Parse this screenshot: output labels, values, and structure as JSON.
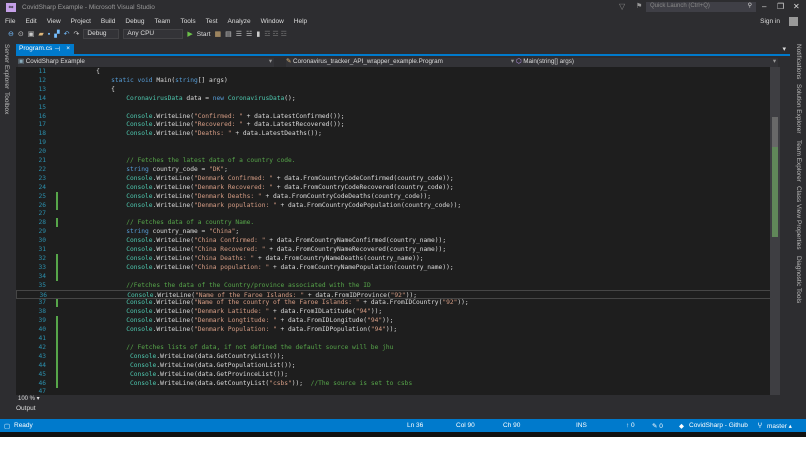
{
  "window": {
    "title": "CovidSharp Example - Microsoft Visual Studio",
    "quick_launch": "Quick Launch (Ctrl+Q)",
    "sign_in": "Sign in"
  },
  "menu": [
    "File",
    "Edit",
    "View",
    "Project",
    "Build",
    "Debug",
    "Team",
    "Tools",
    "Test",
    "Analyze",
    "Window",
    "Help"
  ],
  "toolbar": {
    "config": "Debug",
    "platform": "Any CPU",
    "start": "Start"
  },
  "left_rail": [
    "Server Explorer",
    "Toolbox"
  ],
  "right_rail": [
    "Notifications",
    "Solution Explorer",
    "Team Explorer",
    "Class View",
    "Properties",
    "Diagnostic Tools"
  ],
  "tab": {
    "label": "Program.cs",
    "pin": "⊣",
    "close": "×"
  },
  "navbar": {
    "project": "CovidSharp Example",
    "class": "Coronavirus_tracker_API_wrapper_example.Program",
    "member": "Main(string[] args)"
  },
  "code": [
    {
      "n": "11",
      "seg": [
        [
          "p",
          "        {"
        ]
      ]
    },
    {
      "n": "12",
      "seg": [
        [
          "p",
          "            "
        ],
        [
          "k",
          "static"
        ],
        [
          "p",
          " "
        ],
        [
          "k",
          "void"
        ],
        [
          "p",
          " Main("
        ],
        [
          "k",
          "string"
        ],
        [
          "p",
          "[] args)"
        ]
      ]
    },
    {
      "n": "13",
      "seg": [
        [
          "p",
          "            {"
        ]
      ]
    },
    {
      "n": "14",
      "seg": [
        [
          "p",
          "                "
        ],
        [
          "t",
          "CoronavirusData"
        ],
        [
          "p",
          " data = "
        ],
        [
          "k",
          "new"
        ],
        [
          "p",
          " "
        ],
        [
          "t",
          "CoronavirusData"
        ],
        [
          "p",
          "();"
        ]
      ]
    },
    {
      "n": "15",
      "seg": []
    },
    {
      "n": "16",
      "seg": [
        [
          "p",
          "                "
        ],
        [
          "t",
          "Console"
        ],
        [
          "p",
          ".WriteLine("
        ],
        [
          "s",
          "\"Confirmed: \""
        ],
        [
          "p",
          " + data.LatestConfirmed());"
        ]
      ]
    },
    {
      "n": "17",
      "seg": [
        [
          "p",
          "                "
        ],
        [
          "t",
          "Console"
        ],
        [
          "p",
          ".WriteLine("
        ],
        [
          "s",
          "\"Recovered: \""
        ],
        [
          "p",
          " + data.LatestRecovered());"
        ]
      ]
    },
    {
      "n": "18",
      "seg": [
        [
          "p",
          "                "
        ],
        [
          "t",
          "Console"
        ],
        [
          "p",
          ".WriteLine("
        ],
        [
          "s",
          "\"Deaths: \""
        ],
        [
          "p",
          " + data.LatestDeaths());"
        ]
      ]
    },
    {
      "n": "19",
      "seg": []
    },
    {
      "n": "20",
      "seg": []
    },
    {
      "n": "21",
      "seg": [
        [
          "p",
          "                "
        ],
        [
          "c",
          "// Fetches the latest data of a country code."
        ]
      ]
    },
    {
      "n": "22",
      "seg": [
        [
          "p",
          "                "
        ],
        [
          "k",
          "string"
        ],
        [
          "p",
          " country_code = "
        ],
        [
          "s",
          "\"DK\""
        ],
        [
          "p",
          ";"
        ]
      ]
    },
    {
      "n": "23",
      "seg": [
        [
          "p",
          "                "
        ],
        [
          "t",
          "Console"
        ],
        [
          "p",
          ".WriteLine("
        ],
        [
          "s",
          "\"Denmark Confirmed: \""
        ],
        [
          "p",
          " + data.FromCountryCodeConfirmed(country_code));"
        ]
      ]
    },
    {
      "n": "24",
      "seg": [
        [
          "p",
          "                "
        ],
        [
          "t",
          "Console"
        ],
        [
          "p",
          ".WriteLine("
        ],
        [
          "s",
          "\"Denmark Recovered: \""
        ],
        [
          "p",
          " + data.FromCountryCodeRecovered(country_code));"
        ]
      ]
    },
    {
      "n": "25",
      "chg": true,
      "seg": [
        [
          "p",
          "                "
        ],
        [
          "t",
          "Console"
        ],
        [
          "p",
          ".WriteLine("
        ],
        [
          "s",
          "\"Denmark Deaths: \""
        ],
        [
          "p",
          " + data.FromCountryCodeDeaths(country_code));"
        ]
      ]
    },
    {
      "n": "26",
      "chg": true,
      "seg": [
        [
          "p",
          "                "
        ],
        [
          "t",
          "Console"
        ],
        [
          "p",
          ".WriteLine("
        ],
        [
          "s",
          "\"Denmark population: \""
        ],
        [
          "p",
          " + data.FromCountryCodePopulation(country_code));"
        ]
      ]
    },
    {
      "n": "27",
      "seg": []
    },
    {
      "n": "28",
      "chg": true,
      "seg": [
        [
          "p",
          "                "
        ],
        [
          "c",
          "// Fetches data of a country Name."
        ]
      ]
    },
    {
      "n": "29",
      "seg": [
        [
          "p",
          "                "
        ],
        [
          "k",
          "string"
        ],
        [
          "p",
          " country_name = "
        ],
        [
          "s",
          "\"China\""
        ],
        [
          "p",
          ";"
        ]
      ]
    },
    {
      "n": "30",
      "seg": [
        [
          "p",
          "                "
        ],
        [
          "t",
          "Console"
        ],
        [
          "p",
          ".WriteLine("
        ],
        [
          "s",
          "\"China Confirmed: \""
        ],
        [
          "p",
          " + data.FromCountryNameConfirmed(country_name));"
        ]
      ]
    },
    {
      "n": "31",
      "seg": [
        [
          "p",
          "                "
        ],
        [
          "t",
          "Console"
        ],
        [
          "p",
          ".WriteLine("
        ],
        [
          "s",
          "\"China Recovered: \""
        ],
        [
          "p",
          " + data.FromCountryNameRecovered(country_name));"
        ]
      ]
    },
    {
      "n": "32",
      "chg": true,
      "seg": [
        [
          "p",
          "                "
        ],
        [
          "t",
          "Console"
        ],
        [
          "p",
          ".WriteLine("
        ],
        [
          "s",
          "\"China Deaths: \""
        ],
        [
          "p",
          " + data.FromCountryNameDeaths(country_name));"
        ]
      ]
    },
    {
      "n": "33",
      "chg": true,
      "seg": [
        [
          "p",
          "                "
        ],
        [
          "t",
          "Console"
        ],
        [
          "p",
          ".WriteLine("
        ],
        [
          "s",
          "\"China population: \""
        ],
        [
          "p",
          " + data.FromCountryNamePopulation(country_name));"
        ]
      ]
    },
    {
      "n": "34",
      "chg": true,
      "seg": []
    },
    {
      "n": "35",
      "seg": [
        [
          "p",
          "                "
        ],
        [
          "c",
          "//Fetches the data of the Country/province associated with the ID"
        ]
      ]
    },
    {
      "n": "36",
      "cur": true,
      "seg": [
        [
          "p",
          "                "
        ],
        [
          "t",
          "Console"
        ],
        [
          "p",
          ".WriteLine("
        ],
        [
          "s",
          "\"Name of the Faroe Islands: \""
        ],
        [
          "p",
          " + data.FromIDProvince("
        ],
        [
          "s",
          "\"92\""
        ],
        [
          "p",
          "));"
        ]
      ]
    },
    {
      "n": "37",
      "chg": true,
      "seg": [
        [
          "p",
          "                "
        ],
        [
          "t",
          "Console"
        ],
        [
          "p",
          ".WriteLine("
        ],
        [
          "s",
          "\"Name of the country of the Faroe Islands: \""
        ],
        [
          "p",
          " + data.FromIDCountry("
        ],
        [
          "s",
          "\"92\""
        ],
        [
          "p",
          "));"
        ]
      ]
    },
    {
      "n": "38",
      "seg": [
        [
          "p",
          "                "
        ],
        [
          "t",
          "Console"
        ],
        [
          "p",
          ".WriteLine("
        ],
        [
          "s",
          "\"Denmark Latitude: \""
        ],
        [
          "p",
          " + data.FromIDLatitude("
        ],
        [
          "s",
          "\"94\""
        ],
        [
          "p",
          "));"
        ]
      ]
    },
    {
      "n": "39",
      "chg": true,
      "seg": [
        [
          "p",
          "                "
        ],
        [
          "t",
          "Console"
        ],
        [
          "p",
          ".WriteLine("
        ],
        [
          "s",
          "\"Denmark Longtitude: \""
        ],
        [
          "p",
          " + data.FromIDLongitude("
        ],
        [
          "s",
          "\"94\""
        ],
        [
          "p",
          "));"
        ]
      ]
    },
    {
      "n": "40",
      "chg": true,
      "seg": [
        [
          "p",
          "                "
        ],
        [
          "t",
          "Console"
        ],
        [
          "p",
          ".WriteLine("
        ],
        [
          "s",
          "\"Denmark Population: \""
        ],
        [
          "p",
          " + data.FromIDPopulation("
        ],
        [
          "s",
          "\"94\""
        ],
        [
          "p",
          "));"
        ]
      ]
    },
    {
      "n": "41",
      "chg": true,
      "seg": []
    },
    {
      "n": "42",
      "chg": true,
      "seg": [
        [
          "p",
          "                "
        ],
        [
          "c",
          "// Fetches lists of data, if not defined the default source will be jhu"
        ]
      ]
    },
    {
      "n": "43",
      "chg": true,
      "seg": [
        [
          "p",
          "                 "
        ],
        [
          "t",
          "Console"
        ],
        [
          "p",
          ".WriteLine(data.GetCountryList());"
        ]
      ]
    },
    {
      "n": "44",
      "chg": true,
      "seg": [
        [
          "p",
          "                 "
        ],
        [
          "t",
          "Console"
        ],
        [
          "p",
          ".WriteLine(data.GetPopulationList());"
        ]
      ]
    },
    {
      "n": "45",
      "chg": true,
      "seg": [
        [
          "p",
          "                 "
        ],
        [
          "t",
          "Console"
        ],
        [
          "p",
          ".WriteLine(data.GetProvinceList());"
        ]
      ]
    },
    {
      "n": "46",
      "chg": true,
      "seg": [
        [
          "p",
          "                 "
        ],
        [
          "t",
          "Console"
        ],
        [
          "p",
          ".WriteLine(data.GetCountyList("
        ],
        [
          "s",
          "\"csbs\""
        ],
        [
          "p",
          "));  "
        ],
        [
          "c",
          "//The source is set to csbs"
        ]
      ]
    },
    {
      "n": "47",
      "seg": []
    }
  ],
  "zoom": "100 %",
  "output_label": "Output",
  "status": {
    "ready": "Ready",
    "ln": "Ln 36",
    "col": "Col 90",
    "ch": "Ch 90",
    "mode": "INS",
    "up": "↑ 0",
    "edits": "✎ 0",
    "repo": "CovidSharp - Github",
    "branch": "master ▴"
  }
}
